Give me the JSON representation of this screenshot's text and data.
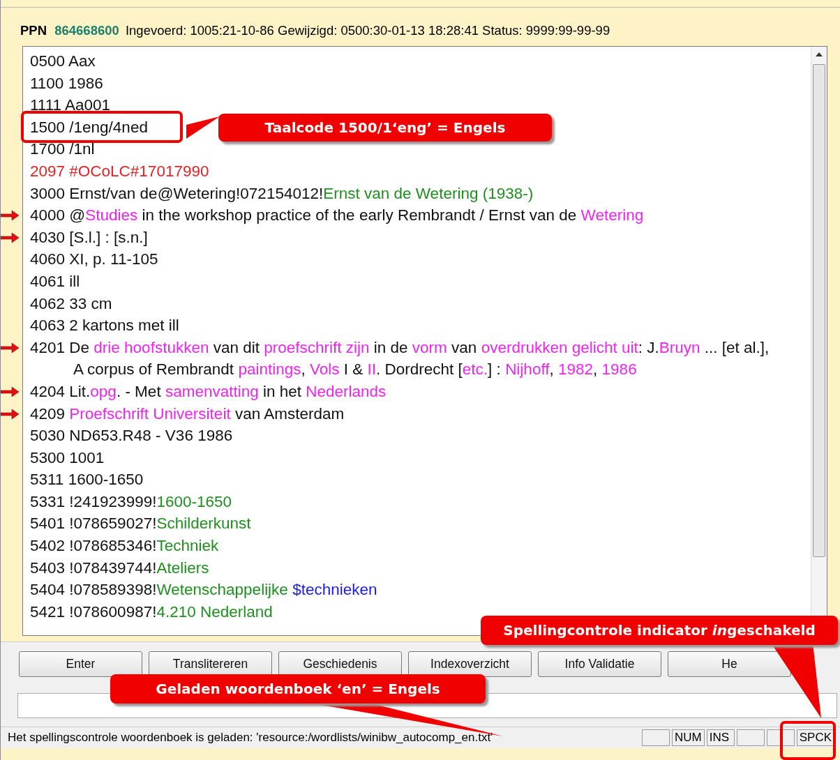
{
  "header": {
    "ppn_label": "PPN",
    "ppn": "864668600",
    "info": "Ingevoerd: 1005:21-10-86 Gewijzigd: 0500:30-01-13 18:28:41 Status: 9999:99-99-99"
  },
  "record": [
    {
      "arrow": false,
      "continuation": false,
      "segments": [
        {
          "text": "0500 Aax",
          "color": "#111111"
        }
      ]
    },
    {
      "arrow": false,
      "continuation": false,
      "segments": [
        {
          "text": "1100 1986",
          "color": "#111111"
        }
      ]
    },
    {
      "arrow": false,
      "continuation": false,
      "segments": [
        {
          "text": "1111 Aa001",
          "color": "#111111"
        }
      ]
    },
    {
      "arrow": false,
      "continuation": false,
      "segments": [
        {
          "text": "1500 /1eng/4ned",
          "color": "#111111"
        }
      ]
    },
    {
      "arrow": false,
      "continuation": false,
      "segments": [
        {
          "text": "1700 /1nl",
          "color": "#111111"
        }
      ]
    },
    {
      "arrow": false,
      "continuation": false,
      "segments": [
        {
          "text": "2097 #OCoLC#17017990",
          "color": "#e02424"
        }
      ]
    },
    {
      "arrow": false,
      "continuation": false,
      "segments": [
        {
          "text": "3000 Ernst/van de@Wetering!072154012!",
          "color": "#111111"
        },
        {
          "text": "Ernst van de Wetering (1938-)",
          "color": "#1f8f1f"
        }
      ]
    },
    {
      "arrow": true,
      "continuation": false,
      "segments": [
        {
          "text": "4000 @",
          "color": "#111111"
        },
        {
          "text": "Studies",
          "color": "#f024f0"
        },
        {
          "text": " in the workshop practice of the early Rembrandt / Ernst van de ",
          "color": "#111111"
        },
        {
          "text": "Wetering",
          "color": "#f024f0"
        }
      ]
    },
    {
      "arrow": true,
      "continuation": false,
      "segments": [
        {
          "text": "4030 [S.l.] : [s.n.]",
          "color": "#111111"
        }
      ]
    },
    {
      "arrow": false,
      "continuation": false,
      "segments": [
        {
          "text": "4060 XI, p. 11-105",
          "color": "#111111"
        }
      ]
    },
    {
      "arrow": false,
      "continuation": false,
      "segments": [
        {
          "text": "4061 ill",
          "color": "#111111"
        }
      ]
    },
    {
      "arrow": false,
      "continuation": false,
      "segments": [
        {
          "text": "4062 33 cm",
          "color": "#111111"
        }
      ]
    },
    {
      "arrow": false,
      "continuation": false,
      "segments": [
        {
          "text": "4063 2 kartons met ill",
          "color": "#111111"
        }
      ]
    },
    {
      "arrow": true,
      "continuation": false,
      "segments": [
        {
          "text": "4201 De ",
          "color": "#111111"
        },
        {
          "text": "drie hoofstukken",
          "color": "#f024f0"
        },
        {
          "text": " van dit ",
          "color": "#111111"
        },
        {
          "text": "proefschrift zijn",
          "color": "#f024f0"
        },
        {
          "text": " in de ",
          "color": "#111111"
        },
        {
          "text": "vorm",
          "color": "#f024f0"
        },
        {
          "text": " van ",
          "color": "#111111"
        },
        {
          "text": "overdrukken gelicht uit",
          "color": "#f024f0"
        },
        {
          "text": ": J.",
          "color": "#111111"
        },
        {
          "text": "Bruyn",
          "color": "#f024f0"
        },
        {
          "text": " ... [et al.],",
          "color": "#111111"
        }
      ]
    },
    {
      "arrow": false,
      "continuation": true,
      "segments": [
        {
          "text": "A corpus of Rembrandt ",
          "color": "#111111"
        },
        {
          "text": "paintings",
          "color": "#f024f0"
        },
        {
          "text": ", ",
          "color": "#111111"
        },
        {
          "text": "Vols",
          "color": "#f024f0"
        },
        {
          "text": " I & ",
          "color": "#111111"
        },
        {
          "text": "II",
          "color": "#f024f0"
        },
        {
          "text": ". Dordrecht [",
          "color": "#111111"
        },
        {
          "text": "etc.",
          "color": "#f024f0"
        },
        {
          "text": "] : ",
          "color": "#111111"
        },
        {
          "text": "Nijhoff",
          "color": "#f024f0"
        },
        {
          "text": ", ",
          "color": "#111111"
        },
        {
          "text": "1982",
          "color": "#f024f0"
        },
        {
          "text": ", ",
          "color": "#111111"
        },
        {
          "text": "1986",
          "color": "#f024f0"
        }
      ]
    },
    {
      "arrow": true,
      "continuation": false,
      "segments": [
        {
          "text": "4204 Lit.",
          "color": "#111111"
        },
        {
          "text": "opg",
          "color": "#f024f0"
        },
        {
          "text": ". - Met ",
          "color": "#111111"
        },
        {
          "text": "samenvatting",
          "color": "#f024f0"
        },
        {
          "text": " in het ",
          "color": "#111111"
        },
        {
          "text": "Nederlands",
          "color": "#f024f0"
        }
      ]
    },
    {
      "arrow": true,
      "continuation": false,
      "segments": [
        {
          "text": "4209 ",
          "color": "#111111"
        },
        {
          "text": "Proefschrift Universiteit",
          "color": "#f024f0"
        },
        {
          "text": " van Amsterdam",
          "color": "#111111"
        }
      ]
    },
    {
      "arrow": false,
      "continuation": false,
      "segments": [
        {
          "text": "5030 ND653.R48 - V36 1986",
          "color": "#111111"
        }
      ]
    },
    {
      "arrow": false,
      "continuation": false,
      "segments": [
        {
          "text": "5300 1001",
          "color": "#111111"
        }
      ]
    },
    {
      "arrow": false,
      "continuation": false,
      "segments": [
        {
          "text": "5311 1600-1650",
          "color": "#111111"
        }
      ]
    },
    {
      "arrow": false,
      "continuation": false,
      "segments": [
        {
          "text": "5331 !241923999!",
          "color": "#111111"
        },
        {
          "text": "1600-1650",
          "color": "#1f8f1f"
        }
      ]
    },
    {
      "arrow": false,
      "continuation": false,
      "segments": [
        {
          "text": "5401 !078659027!",
          "color": "#111111"
        },
        {
          "text": "Schilderkunst",
          "color": "#1f8f1f"
        }
      ]
    },
    {
      "arrow": false,
      "continuation": false,
      "segments": [
        {
          "text": "5402 !078685346!",
          "color": "#111111"
        },
        {
          "text": "Techniek",
          "color": "#1f8f1f"
        }
      ]
    },
    {
      "arrow": false,
      "continuation": false,
      "segments": [
        {
          "text": "5403 !078439744!",
          "color": "#111111"
        },
        {
          "text": "Ateliers",
          "color": "#1f8f1f"
        }
      ]
    },
    {
      "arrow": false,
      "continuation": false,
      "segments": [
        {
          "text": "5404 !078589398!",
          "color": "#111111"
        },
        {
          "text": "Wetenschappelijke ",
          "color": "#1f8f1f"
        },
        {
          "text": "$technieken",
          "color": "#1c1cf0"
        }
      ]
    },
    {
      "arrow": false,
      "continuation": false,
      "segments": [
        {
          "text": "5421 !078600987!",
          "color": "#111111"
        },
        {
          "text": "4.210 Nederland",
          "color": "#1f8f1f"
        }
      ]
    }
  ],
  "buttons": [
    "Enter",
    "Translitereren",
    "Geschiedenis",
    "Indexoverzicht",
    "Info Validatie",
    "He"
  ],
  "status_bar": {
    "message": "Het spellingscontrole woordenboek is geladen:  'resource:/wordlists/winibw_autocomp_en.txt'",
    "indicators": [
      {
        "kind": "empty"
      },
      {
        "kind": "label",
        "label": "NUM"
      },
      {
        "kind": "label",
        "label": "INS"
      },
      {
        "kind": "empty"
      },
      {
        "kind": "empty"
      },
      {
        "kind": "label",
        "label": "SPCK"
      }
    ]
  },
  "annotations": [
    {
      "kind": "left",
      "parts": [
        {
          "text": "Taalcode 1500/1‘eng’ = Engels",
          "italic": false
        }
      ]
    },
    {
      "kind": "down-right",
      "parts": [
        {
          "text": "Spellingcontrole indicator ",
          "italic": false
        },
        {
          "text": "in",
          "italic": true
        },
        {
          "text": "geschakeld",
          "italic": false
        }
      ]
    },
    {
      "kind": "down",
      "parts": [
        {
          "text": "Geladen woordenboek ‘en’ = Engels",
          "italic": false
        }
      ]
    }
  ]
}
